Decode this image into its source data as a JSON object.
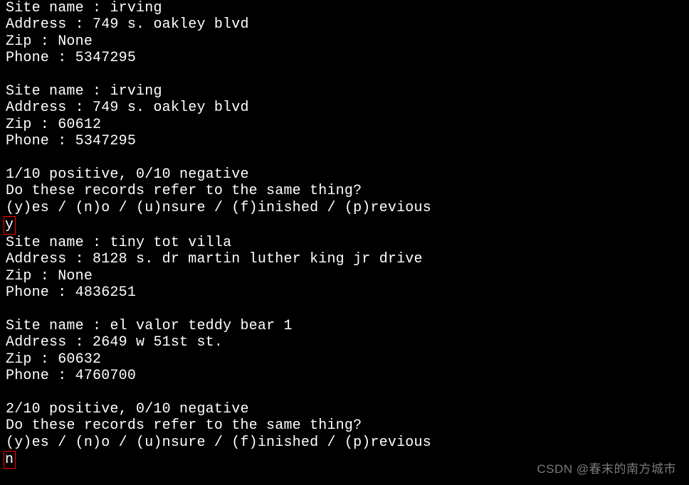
{
  "record1a": {
    "site_label": "Site name : ",
    "site": "irving",
    "addr_label": "Address : ",
    "addr": "749 s. oakley blvd",
    "zip_label": "Zip : ",
    "zip": "None",
    "phone_label": "Phone : ",
    "phone": "5347295"
  },
  "record1b": {
    "site_label": "Site name : ",
    "site": "irving",
    "addr_label": "Address : ",
    "addr": "749 s. oakley blvd",
    "zip_label": "Zip : ",
    "zip": "60612",
    "phone_label": "Phone : ",
    "phone": "5347295"
  },
  "prompt1": {
    "score": "1/10 positive, 0/10 negative",
    "question": "Do these records refer to the same thing?",
    "options": "(y)es / (n)o / (u)nsure / (f)inished / (p)revious",
    "answer": "y"
  },
  "record2a": {
    "site_label": "Site name : ",
    "site": "tiny tot villa",
    "addr_label": "Address : ",
    "addr": "8128 s. dr martin luther king jr drive",
    "zip_label": "Zip : ",
    "zip": "None",
    "phone_label": "Phone : ",
    "phone": "4836251"
  },
  "record2b": {
    "site_label": "Site name : ",
    "site": "el valor teddy bear 1",
    "addr_label": "Address : ",
    "addr": "2649 w 51st st.",
    "zip_label": "Zip : ",
    "zip": "60632",
    "phone_label": "Phone : ",
    "phone": "4760700"
  },
  "prompt2": {
    "score": "2/10 positive, 0/10 negative",
    "question": "Do these records refer to the same thing?",
    "options": "(y)es / (n)o / (u)nsure / (f)inished / (p)revious",
    "answer": "n"
  },
  "watermark": "CSDN @春末的南方城市"
}
